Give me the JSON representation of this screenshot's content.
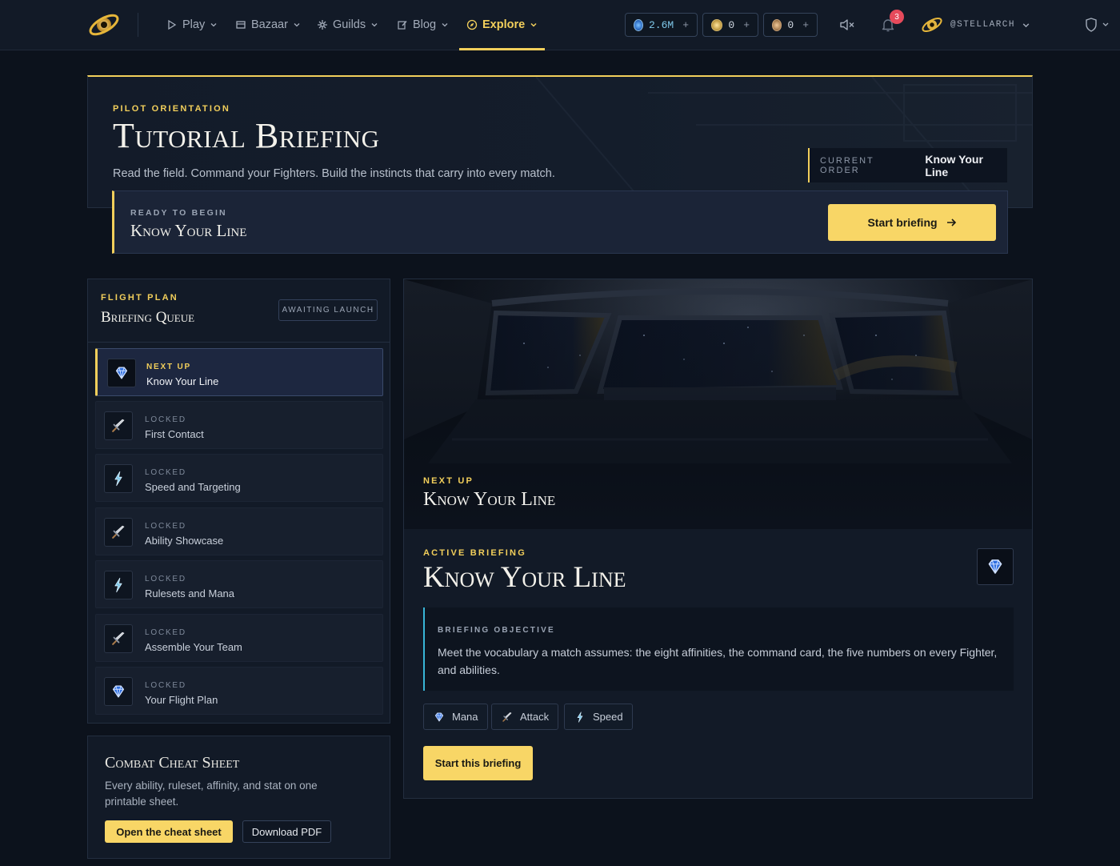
{
  "nav": {
    "items": [
      {
        "label": "Play",
        "icon": "play-icon"
      },
      {
        "label": "Bazaar",
        "icon": "store-icon"
      },
      {
        "label": "Guilds",
        "icon": "guild-icon"
      },
      {
        "label": "Blog",
        "icon": "edit-icon"
      },
      {
        "label": "Explore",
        "icon": "compass-icon",
        "active": true
      }
    ],
    "currencies": [
      {
        "value": "2.6M",
        "plus": "+",
        "color": "#3d8fd8"
      },
      {
        "value": "0",
        "plus": "+",
        "color": "#c6a14a"
      },
      {
        "value": "0",
        "plus": "+",
        "color": "#b0875a"
      }
    ],
    "notification_count": "3",
    "username": "@STELLARCH"
  },
  "hero": {
    "eyebrow": "Pilot Orientation",
    "title": "Tutorial Briefing",
    "subtitle": "Read the field. Command your Fighters. Build the instincts that carry into every match.",
    "order_label": "CURRENT ORDER",
    "order_value": "Know Your Line"
  },
  "ready": {
    "eyebrow": "Ready to begin",
    "title": "Know Your Line",
    "button": "Start briefing"
  },
  "queue": {
    "eyebrow": "Flight Plan",
    "title": "Briefing Queue",
    "chip": "AWAITING LAUNCH",
    "items": [
      {
        "status": "Next up",
        "name": "Know Your Line",
        "icon": "gem-icon"
      },
      {
        "status": "Locked",
        "name": "First Contact",
        "icon": "sword-icon"
      },
      {
        "status": "Locked",
        "name": "Speed and Targeting",
        "icon": "bolt-icon"
      },
      {
        "status": "Locked",
        "name": "Ability Showcase",
        "icon": "sword-icon"
      },
      {
        "status": "Locked",
        "name": "Rulesets and Mana",
        "icon": "bolt-icon"
      },
      {
        "status": "Locked",
        "name": "Assemble Your Team",
        "icon": "sword-icon"
      },
      {
        "status": "Locked",
        "name": "Your Flight Plan",
        "icon": "gem-icon"
      }
    ]
  },
  "cheat": {
    "title": "Combat Cheat Sheet",
    "desc": "Every ability, ruleset, affinity, and stat on one printable sheet.",
    "open": "Open the cheat sheet",
    "download": "Download PDF"
  },
  "detail": {
    "banner_eyebrow": "Next up",
    "banner_title": "Know Your Line",
    "eyebrow": "Active Briefing",
    "title": "Know Your Line",
    "objective_label": "Briefing Objective",
    "objective": "Meet the vocabulary a match assumes: the eight affinities, the command card, the five numbers on every Fighter, and abilities.",
    "tags": [
      {
        "label": "Mana",
        "icon": "gem-icon"
      },
      {
        "label": "Attack",
        "icon": "sword-icon"
      },
      {
        "label": "Speed",
        "icon": "bolt-icon"
      }
    ],
    "button": "Start this briefing"
  },
  "colors": {
    "accent": "#f2cf5b",
    "cyan": "#38b5d6",
    "bg": "#0c121c"
  }
}
